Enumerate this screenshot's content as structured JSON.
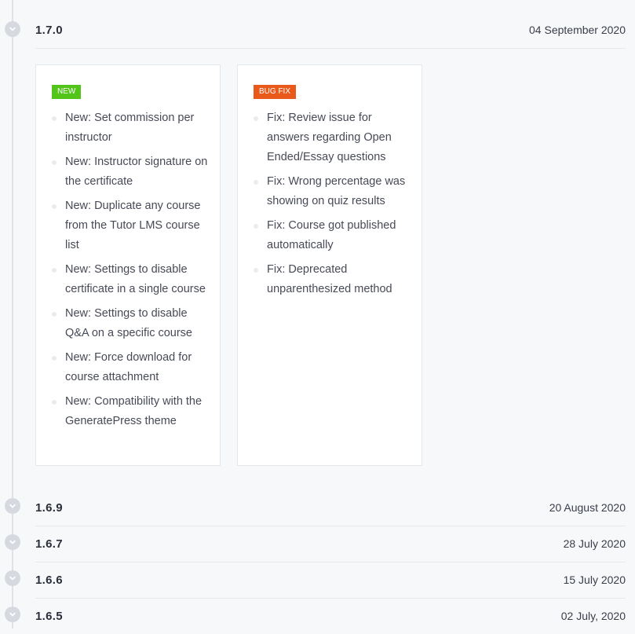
{
  "releases": [
    {
      "version": "1.7.0",
      "date": "04 September 2020",
      "expanded": true
    },
    {
      "version": "1.6.9",
      "date": "20 August 2020",
      "expanded": false
    },
    {
      "version": "1.6.7",
      "date": "28 July 2020",
      "expanded": false
    },
    {
      "version": "1.6.6",
      "date": "15 July 2020",
      "expanded": false
    },
    {
      "version": "1.6.5",
      "date": "02 July, 2020",
      "expanded": false
    }
  ],
  "cards": {
    "new": {
      "badge": "NEW",
      "badge_color": "#52c41a",
      "items": [
        "New: Set commission per instructor",
        "New: Instructor signature on the certificate",
        "New: Duplicate any course from the Tutor LMS course list",
        "New: Settings to disable certificate in a single course",
        "New: Settings to disable Q&A on a specific course",
        "New: Force download for course attachment",
        "New: Compatibility with the GeneratePress theme"
      ]
    },
    "bugfix": {
      "badge": "BUG FIX",
      "badge_color": "#e8591a",
      "items": [
        "Fix: Review issue for answers regarding Open Ended/Essay questions",
        "Fix: Wrong percentage was showing on quiz results",
        "Fix: Course got published automatically",
        "Fix: Deprecated unparenthesized method"
      ]
    }
  },
  "icons": {
    "toggle": "chevron-down-icon"
  }
}
